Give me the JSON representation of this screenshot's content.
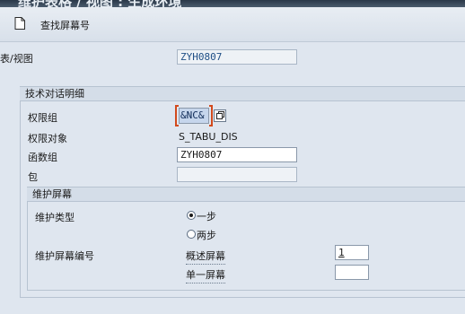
{
  "window": {
    "title": "维护表格 / 视图 : 生成环境"
  },
  "toolbar": {
    "find_screen_label": "查找屏幕号"
  },
  "table_view": {
    "label": "表/视图",
    "value": "ZYH0807"
  },
  "tech_dialog": {
    "header": "技术对话明细",
    "auth_group_label": "权限组",
    "auth_group_value": "&NC&",
    "auth_object_label": "权限对象",
    "auth_object_value": "S_TABU_DIS",
    "function_group_label": "函数组",
    "function_group_value": "ZYH0807",
    "package_label": "包",
    "package_value": ""
  },
  "maint_screen": {
    "header": "维护屏幕",
    "type_label": "维护类型",
    "one_step_label": "一步",
    "two_step_label": "两步",
    "one_step_selected": true,
    "screen_no_label": "维护屏幕编号",
    "overview_label": "概述屏幕",
    "overview_value": "1",
    "single_label": "单一屏幕",
    "single_value": ""
  }
}
